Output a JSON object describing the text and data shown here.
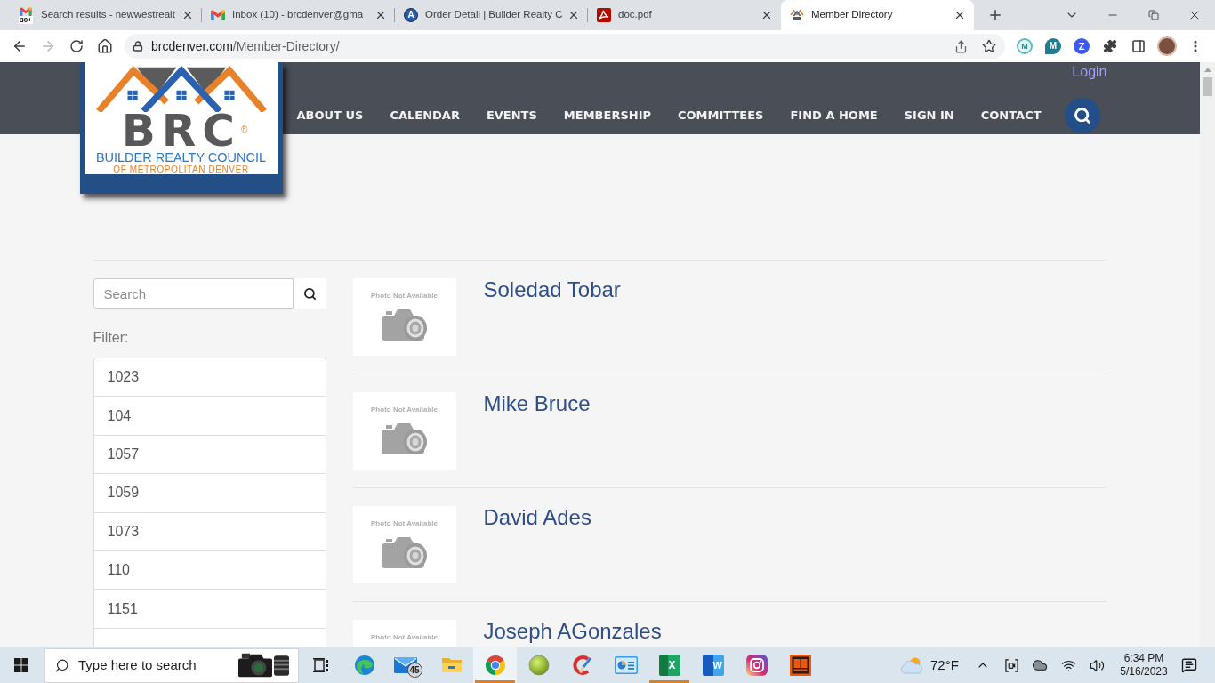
{
  "browser": {
    "tabs": [
      {
        "title": "Search results - newwestrealt",
        "selected": false,
        "badge": "30+"
      },
      {
        "title": "Inbox (10) - brcdenver@gma",
        "selected": false
      },
      {
        "title": "Order Detail | Builder Realty C",
        "selected": false,
        "glyph": "A"
      },
      {
        "title": "doc.pdf",
        "selected": false
      },
      {
        "title": "Member Directory",
        "selected": true
      }
    ],
    "address": {
      "domain": "brcdenver.com",
      "path": "/Member-Directory/"
    },
    "extensions": [
      {
        "glyph": "M"
      },
      {
        "glyph": "M"
      },
      {
        "glyph": "Z"
      }
    ]
  },
  "header": {
    "logo": {
      "letters": "BRC",
      "mark": "®",
      "title": "BUILDER REALTY COUNCIL",
      "subtitle": "OF METROPOLITAN DENVER"
    },
    "login": "Login",
    "nav": [
      "ABOUT US",
      "CALENDAR",
      "EVENTS",
      "MEMBERSHIP",
      "COMMITTEES",
      "FIND A HOME",
      "SIGN IN",
      "CONTACT"
    ]
  },
  "sidebar": {
    "search": {
      "placeholder": "Search"
    },
    "filter_label": "Filter:",
    "filters": [
      "1023",
      "104",
      "1057",
      "1059",
      "1073",
      "110",
      "1151"
    ]
  },
  "members": [
    {
      "name": "Soledad Tobar",
      "photo": {
        "label": "Photo Not Available",
        "camera": true
      }
    },
    {
      "name": "Mike Bruce",
      "photo": {
        "label": "Photo Not Available",
        "camera": true
      }
    },
    {
      "name": "David Ades",
      "photo": {
        "label": "Photo Not Available",
        "camera": true
      }
    },
    {
      "name": "Joseph AGonzales",
      "photo": {
        "label": "Photo Not Available"
      }
    }
  ],
  "taskbar": {
    "search": {
      "placeholder": "Type here to search"
    },
    "apps": [
      {
        "running": false,
        "selected": false
      },
      {
        "running": false,
        "selected": false,
        "badge": "45"
      },
      {
        "running": false,
        "selected": false
      },
      {
        "running": true,
        "selected": true
      },
      {
        "running": false,
        "selected": false
      },
      {
        "running": false,
        "selected": false
      },
      {
        "running": false,
        "selected": false
      },
      {
        "running": true,
        "selected": false,
        "glyph": "X"
      },
      {
        "running": false,
        "selected": false,
        "glyph": "W"
      },
      {
        "running": false,
        "selected": false
      },
      {
        "running": false,
        "selected": false
      }
    ],
    "weather": "72°F",
    "time": "6:34 PM",
    "date": "5/16/2023"
  }
}
